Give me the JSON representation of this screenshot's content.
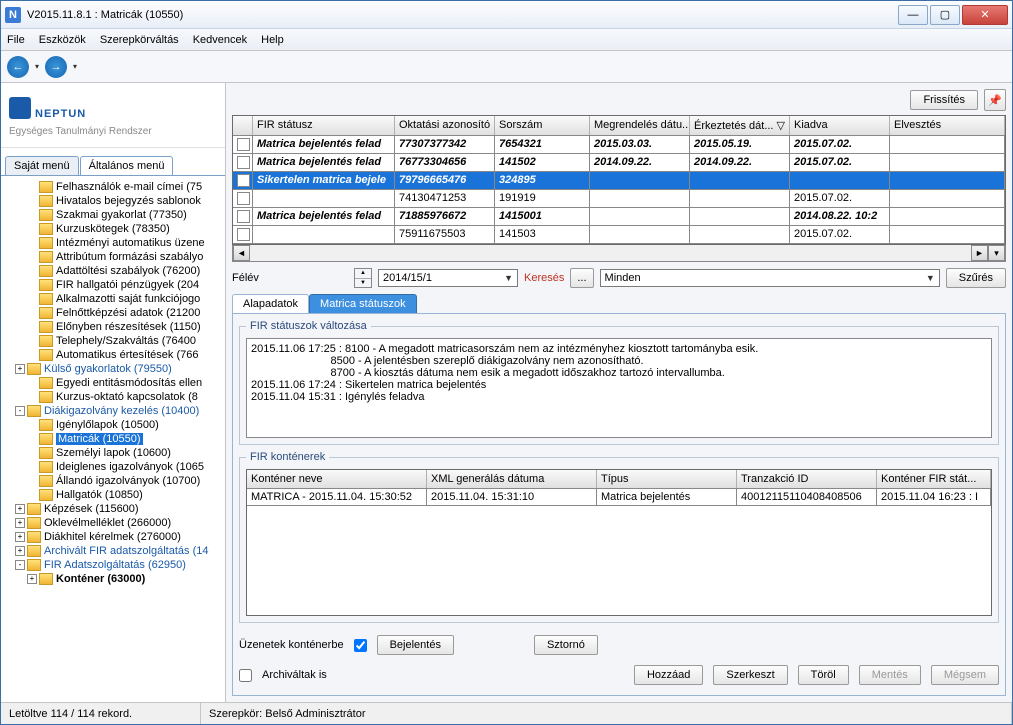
{
  "window": {
    "title": "V2015.11.8.1 : Matricák (10550)"
  },
  "menu": {
    "items": [
      "File",
      "Eszközök",
      "Szerepkörváltás",
      "Kedvencek",
      "Help"
    ]
  },
  "logo": {
    "brand": "NEPTUN",
    "sub": "Egységes Tanulmányi Rendszer"
  },
  "sidetabs": {
    "t1": "Saját menü",
    "t2": "Általános menü"
  },
  "tree": [
    [
      "",
      2,
      "Felhasználók e-mail címei (75",
      ""
    ],
    [
      "",
      2,
      "Hivatalos bejegyzés sablonok",
      ""
    ],
    [
      "",
      2,
      "Szakmai gyakorlat (77350)",
      ""
    ],
    [
      "",
      2,
      "Kurzuskötegek (78350)",
      ""
    ],
    [
      "",
      2,
      "Intézményi automatikus üzene",
      ""
    ],
    [
      "",
      2,
      "Attribútum formázási szabályo",
      ""
    ],
    [
      "",
      2,
      "Adattöltési szabályok (76200)",
      ""
    ],
    [
      "",
      2,
      "FIR hallgatói pénzügyek (204",
      ""
    ],
    [
      "",
      2,
      "Alkalmazotti saját funkciójogo",
      ""
    ],
    [
      "",
      2,
      "Felnőttképzési adatok (21200",
      ""
    ],
    [
      "",
      2,
      "Előnyben részesítések (1150)",
      ""
    ],
    [
      "",
      2,
      "Telephely/Szakváltás (76400",
      ""
    ],
    [
      "",
      2,
      "Automatikus értesítések (766",
      ""
    ],
    [
      "+",
      1,
      "Külső gyakorlatok (79550)",
      "blue"
    ],
    [
      "",
      2,
      "Egyedi entitásmódosítás ellen",
      ""
    ],
    [
      "",
      2,
      "Kurzus-oktató kapcsolatok (8",
      ""
    ],
    [
      "-",
      1,
      "Diákigazolvány kezelés (10400)",
      "blue"
    ],
    [
      "",
      2,
      "Igénylőlapok (10500)",
      ""
    ],
    [
      "",
      2,
      "Matricák (10550)",
      "selected"
    ],
    [
      "",
      2,
      "Személyi lapok (10600)",
      ""
    ],
    [
      "",
      2,
      "Ideiglenes igazolványok (1065",
      ""
    ],
    [
      "",
      2,
      "Állandó igazolványok (10700)",
      ""
    ],
    [
      "",
      2,
      "Hallgatók (10850)",
      ""
    ],
    [
      "+",
      1,
      "Képzések (115600)",
      ""
    ],
    [
      "+",
      1,
      "Oklevélmelléklet (266000)",
      ""
    ],
    [
      "+",
      1,
      "Diákhitel kérelmek (276000)",
      ""
    ],
    [
      "+",
      1,
      "Archivált FIR adatszolgáltatás (14",
      "blue"
    ],
    [
      "-",
      1,
      "FIR Adatszolgáltatás (62950)",
      "blue"
    ],
    [
      "+",
      2,
      "Konténer (63000)",
      "bold"
    ]
  ],
  "toprow": {
    "refresh": "Frissítés"
  },
  "grid": {
    "headers": [
      "FIR státusz",
      "Oktatási azonosító",
      "Sorszám",
      "Megrendelés dátu...",
      "Érkeztetés dát... ▽",
      "Kiadva",
      "Elvesztés"
    ],
    "rows": [
      {
        "bold": true,
        "cells": [
          "Matrica bejelentés felad",
          "77307377342",
          "7654321",
          "2015.03.03.",
          "2015.05.19.",
          "2015.07.02.",
          ""
        ]
      },
      {
        "bold": true,
        "cells": [
          "Matrica bejelentés felad",
          "76773304656",
          "141502",
          "2014.09.22.",
          "2014.09.22.",
          "2015.07.02.",
          ""
        ]
      },
      {
        "selected": true,
        "cells": [
          "Sikertelen matrica bejele",
          "79796665476",
          "324895",
          "",
          "",
          "",
          ""
        ]
      },
      {
        "cells": [
          "",
          "74130471253",
          "191919",
          "",
          "",
          "2015.07.02.",
          ""
        ]
      },
      {
        "bold": true,
        "cells": [
          "Matrica bejelentés felad",
          "71885976672",
          "1415001",
          "",
          "",
          "2014.08.22. 10:2",
          ""
        ]
      },
      {
        "cells": [
          "",
          "75911675503",
          "141503",
          "",
          "",
          "2015.07.02.",
          ""
        ]
      }
    ]
  },
  "search": {
    "felev": "Félév",
    "felev_value": "2014/15/1",
    "kereses": "Keresés",
    "minden": "Minden",
    "szures": "Szűrés"
  },
  "tabs2": {
    "t1": "Alapadatok",
    "t2": "Matrica státuszok"
  },
  "fieldset1": {
    "legend": "FIR státuszok változása",
    "log": "2015.11.06 17:25 : 8100 - A megadott matricasorszám nem az intézményhez kiosztott tartományba esik.\n                          8500 - A jelentésben szereplő diákigazolvány nem azonosítható.\n                          8700 - A kiosztás dátuma nem esik a megadott időszakhoz tartozó intervallumba.\n2015.11.06 17:24 : Sikertelen matrica bejelentés\n2015.11.04 15:31 : Igénylés feladva"
  },
  "fieldset2": {
    "legend": "FIR konténerek",
    "headers": [
      "Konténer neve",
      "XML generálás dátuma",
      "Típus",
      "Tranzakció ID",
      "Konténer FIR stát..."
    ],
    "row": [
      "MATRICA - 2015.11.04. 15:30:52",
      "2015.11.04. 15:31:10",
      "Matrica bejelentés",
      "40012115110408408506",
      "2015.11.04 16:23 : I"
    ]
  },
  "bottom": {
    "uzenetek": "Üzenetek konténerbe",
    "bejelentes": "Bejelentés",
    "sztorno": "Sztornó",
    "archivalt": "Archiváltak is",
    "hozzaad": "Hozzáad",
    "szerkeszt": "Szerkeszt",
    "torol": "Töröl",
    "mentes": "Mentés",
    "megsem": "Mégsem"
  },
  "status": {
    "left": "Letöltve 114 / 114 rekord.",
    "right": "Szerepkör: Belső Adminisztrátor"
  }
}
